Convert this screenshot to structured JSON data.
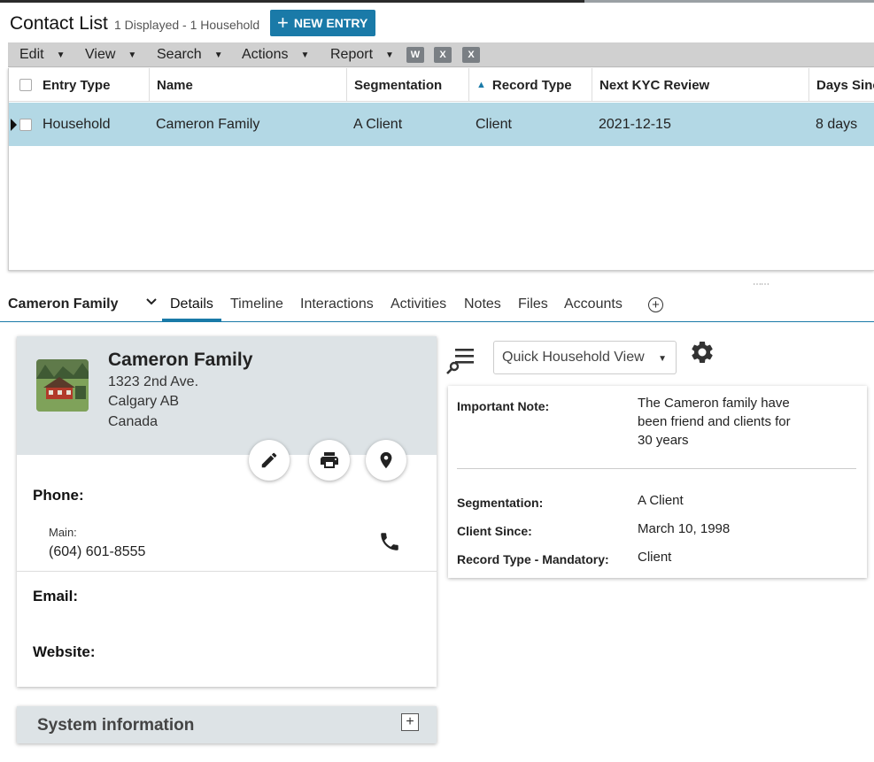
{
  "header": {
    "title": "Contact List",
    "subtitle": "1 Displayed - 1 Household",
    "new_entry_label": "NEW ENTRY"
  },
  "menubar": {
    "items": [
      "Edit",
      "View",
      "Search",
      "Actions",
      "Report"
    ],
    "export_icons": [
      "word-export-icon",
      "excel-export-icon",
      "excel-download-icon"
    ]
  },
  "grid": {
    "columns": [
      "Entry Type",
      "Name",
      "Segmentation",
      "Record Type",
      "Next KYC Review",
      "Days Since"
    ],
    "sorted_column": "Record Type",
    "rows": [
      {
        "entry_type": "Household",
        "name": "Cameron Family",
        "segmentation": "A Client",
        "record_type": "Client",
        "next_kyc": "2021-12-15",
        "days_since": "8 days"
      }
    ]
  },
  "tabs": {
    "record_name": "Cameron Family",
    "items": [
      "Details",
      "Timeline",
      "Interactions",
      "Activities",
      "Notes",
      "Files",
      "Accounts"
    ],
    "active": "Details"
  },
  "contact_card": {
    "name": "Cameron Family",
    "address_line1": "1323 2nd Ave.",
    "address_line2": "Calgary AB",
    "address_line3": "Canada",
    "phone_label": "Phone:",
    "phone_type": "Main:",
    "phone_number": "(604) 601-8555",
    "email_label": "Email:",
    "website_label": "Website:"
  },
  "system_info": {
    "title": "System information"
  },
  "quick_view": {
    "selected": "Quick Household View",
    "important_note_label": "Important Note:",
    "important_note_value": "The Cameron family have been friend and clients for 30 years",
    "fields": [
      {
        "label": "Segmentation:",
        "value": "A Client"
      },
      {
        "label": "Client Since:",
        "value": "March 10, 1998"
      },
      {
        "label": "Record Type - Mandatory:",
        "value": "Client"
      }
    ]
  },
  "colors": {
    "accent": "#1a7aa8",
    "selected_row": "#b3d8e5",
    "card_header": "#dde3e6",
    "menubar": "#d0d0d0"
  }
}
